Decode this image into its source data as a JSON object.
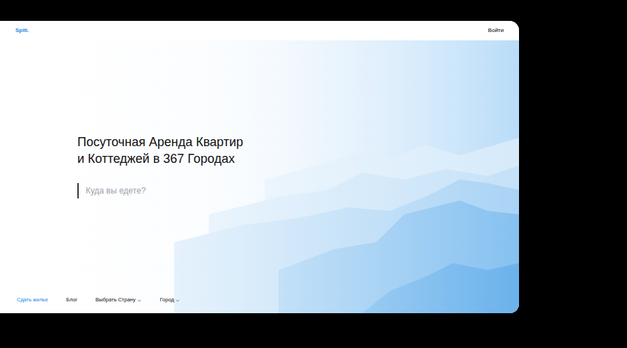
{
  "header": {
    "logo": "Spiti.",
    "login": "Войти"
  },
  "hero": {
    "title_lines": [
      "Посуточная Аренда Квартир",
      "и Коттеджей в 367 Городах"
    ],
    "search": {
      "placeholder": "Куда вы едете?"
    }
  },
  "footer": {
    "links": [
      {
        "label": "Сдать жилье",
        "selected": true,
        "dropdown": false
      },
      {
        "label": "Блог",
        "selected": false,
        "dropdown": false
      },
      {
        "label": "Выбрать Страну",
        "selected": false,
        "dropdown": true
      },
      {
        "label": "Город",
        "selected": false,
        "dropdown": true
      }
    ]
  }
}
